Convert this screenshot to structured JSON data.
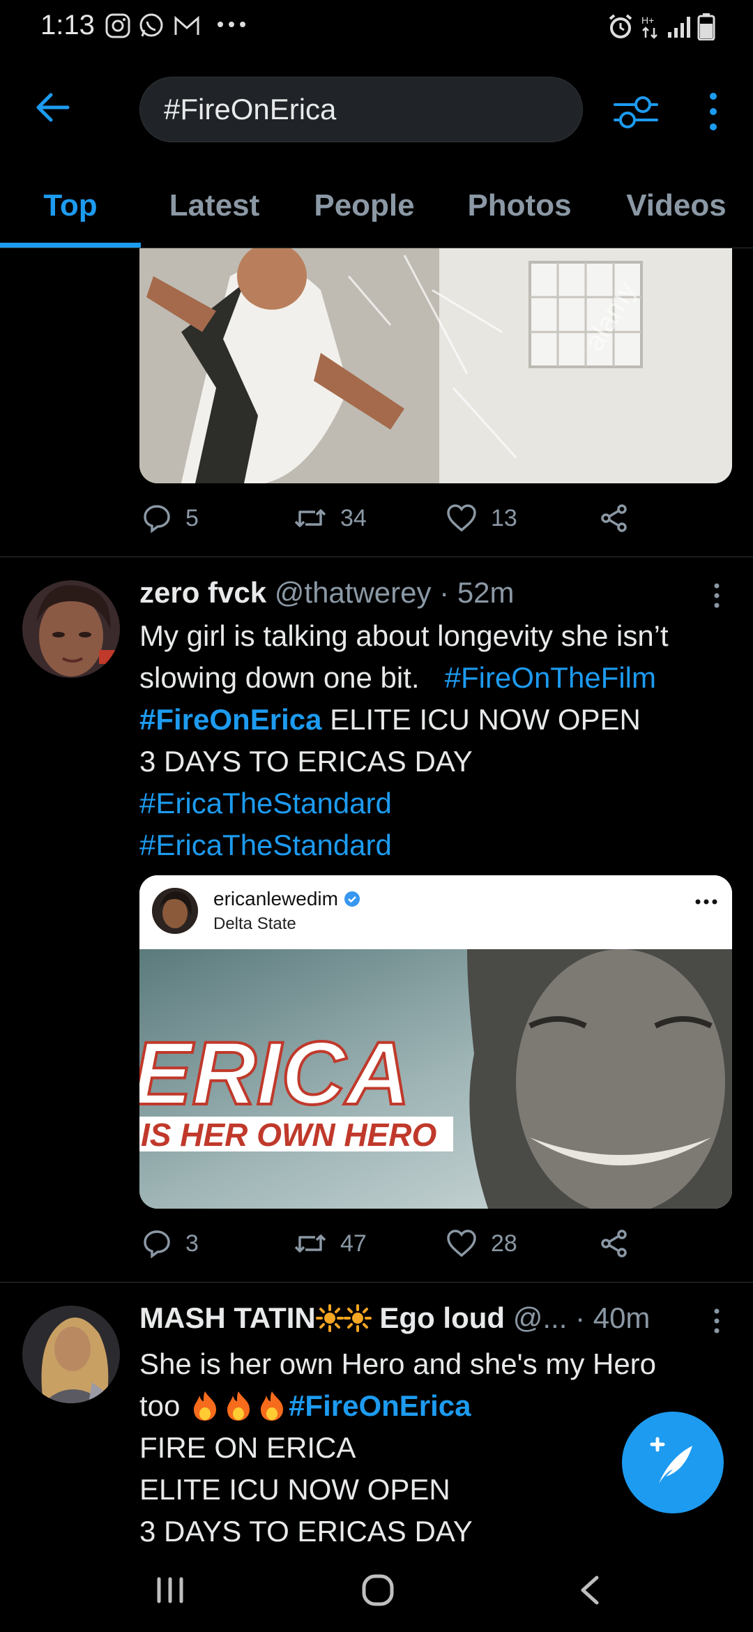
{
  "status_bar": {
    "time": "1:13",
    "left_icons": [
      "instagram-icon",
      "whatsapp-icon",
      "gmail-icon",
      "more-dots-icon"
    ],
    "right_icons": [
      "alarm-icon",
      "data-arrows-icon",
      "signal-icon",
      "battery-icon"
    ]
  },
  "header": {
    "search_value": "#FireOnErica"
  },
  "tabs": [
    {
      "label": "Top",
      "active": true
    },
    {
      "label": "Latest",
      "active": false
    },
    {
      "label": "People",
      "active": false
    },
    {
      "label": "Photos",
      "active": false
    },
    {
      "label": "Videos",
      "active": false
    }
  ],
  "tweets": [
    {
      "media_watermark": "alamy",
      "actions": {
        "replies": "5",
        "retweets": "34",
        "likes": "13"
      }
    },
    {
      "name": "zero fvck",
      "handle": "@thatwerey",
      "time": "· 52m",
      "body": {
        "line1": "My girl is talking about longevity she isn’t",
        "line2_text": "slowing down one bit.",
        "line2_tag": "#FireOnTheFilm",
        "line3_tag": "#FireOnErica",
        "line3_text": " ELITE ICU NOW OPEN",
        "line4": "3 DAYS TO ERICAS DAY",
        "line5_tag": "#EricaTheStandard",
        "line6_tag": "#EricaTheStandard"
      },
      "embed": {
        "username": "ericanlewedim",
        "location": "Delta State",
        "image_title": "ERICA",
        "image_subtitle": "IS HER OWN HERO"
      },
      "actions": {
        "replies": "3",
        "retweets": "47",
        "likes": "28"
      }
    },
    {
      "name": "MASH TATIN",
      "name_suffix": "Ego loud",
      "handle": "@...",
      "time": "· 40m",
      "body": {
        "line1": "She is her own Hero and she's my Hero",
        "line2_text": "too ",
        "line2_tag": "#FireOnErica",
        "line3": "FIRE ON ERICA",
        "line4": "ELITE ICU NOW OPEN",
        "line5": "3 DAYS TO ERICAS DAY"
      }
    }
  ],
  "colors": {
    "accent": "#1d9bf0",
    "background": "#000000",
    "muted_text": "#8b98a5",
    "divider": "#2f3336"
  }
}
